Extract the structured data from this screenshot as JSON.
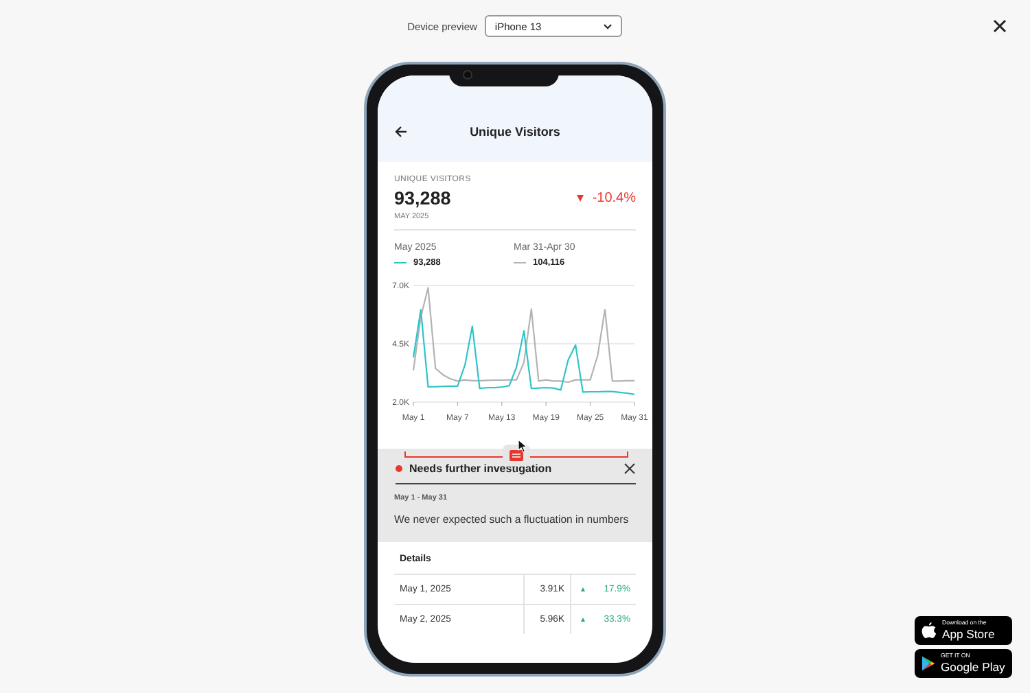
{
  "toolbar": {
    "device_label": "Device preview",
    "device_select": "iPhone 13"
  },
  "app": {
    "title": "Unique Visitors",
    "metric": {
      "label": "UNIQUE VISITORS",
      "value": "93,288",
      "period": "MAY 2025",
      "change": "-10.4%",
      "rising": false
    },
    "legend_totals": [
      "93,288",
      "104,116"
    ],
    "chart_data": {
      "type": "line",
      "categories": [
        "May 1",
        null,
        null,
        null,
        null,
        null,
        "May 7",
        null,
        null,
        null,
        null,
        null,
        "May 13",
        null,
        null,
        null,
        null,
        null,
        "May 19",
        null,
        null,
        null,
        null,
        null,
        "May 25",
        null,
        null,
        null,
        null,
        null,
        "May 31"
      ],
      "ylim": [
        2000,
        7000
      ],
      "yticks": [
        {
          "value": 2000,
          "label": "2.0K"
        },
        {
          "value": 4500,
          "label": "4.5K"
        },
        {
          "value": 7000,
          "label": "7.0K"
        }
      ],
      "series": [
        {
          "name": "May 2025",
          "color": "#2ec4c9",
          "values": [
            3910,
            5960,
            2660,
            2660,
            2670,
            2680,
            2680,
            3600,
            5250,
            2580,
            2620,
            2620,
            2650,
            2700,
            3500,
            5050,
            2580,
            2600,
            2620,
            2600,
            2520,
            3800,
            4450,
            2430,
            2440,
            2440,
            2450,
            2450,
            2420,
            2380,
            2330
          ]
        },
        {
          "name": "Mar 31-Apr 30",
          "color": "#b3b3b3",
          "values": [
            3360,
            5640,
            6900,
            3440,
            3170,
            3000,
            2900,
            2950,
            2920,
            2920,
            2930,
            2940,
            2940,
            2950,
            2950,
            3700,
            5990,
            2900,
            2950,
            2900,
            2900,
            2850,
            2950,
            2950,
            2950,
            4000,
            5970,
            2900,
            2900,
            2920,
            2920
          ]
        }
      ]
    },
    "range_slider": {
      "level": 0.5
    },
    "annotation": {
      "title": "Needs further investigation",
      "date_range": "May 1 - May 31",
      "text": "We never expected such a fluctuation in numbers"
    },
    "details": {
      "title": "Details",
      "rows": [
        {
          "date": "May 1, 2025",
          "value": "3.91K",
          "change": "17.9%",
          "rising": true
        },
        {
          "date": "May 2, 2025",
          "value": "5.96K",
          "change": "33.3%",
          "rising": true
        }
      ]
    }
  },
  "store_badges": [
    {
      "kind": "apple",
      "small": "Download on the",
      "big": "App Store"
    },
    {
      "kind": "google",
      "small": "GET IT ON",
      "big": "Google Play"
    }
  ]
}
